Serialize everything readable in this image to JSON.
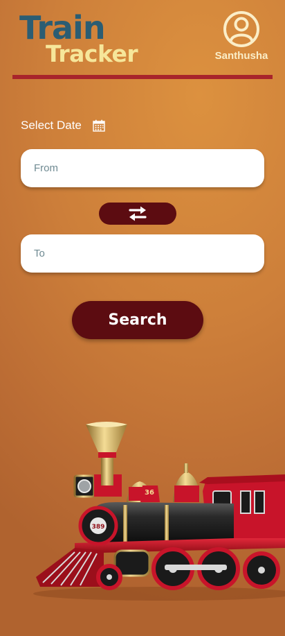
{
  "app": {
    "logo_line1": "Train",
    "logo_line2": "Tracker"
  },
  "profile": {
    "name": "Santhusha",
    "icon": "user-circle-icon"
  },
  "form": {
    "date_label": "Select Date",
    "date_icon": "calendar-icon",
    "from_placeholder": "From",
    "to_placeholder": "To",
    "swap_icon": "swap-arrows-icon",
    "search_label": "Search"
  },
  "train_image": {
    "number_tender": "36",
    "number_front": "389"
  },
  "colors": {
    "background": "#cd7f3a",
    "logo_train": "#2b5d73",
    "logo_tracker": "#f6e69a",
    "profile": "#fbeec8",
    "divider": "#a8242b",
    "button": "#5c0c11",
    "input_bg": "#ffffff"
  }
}
